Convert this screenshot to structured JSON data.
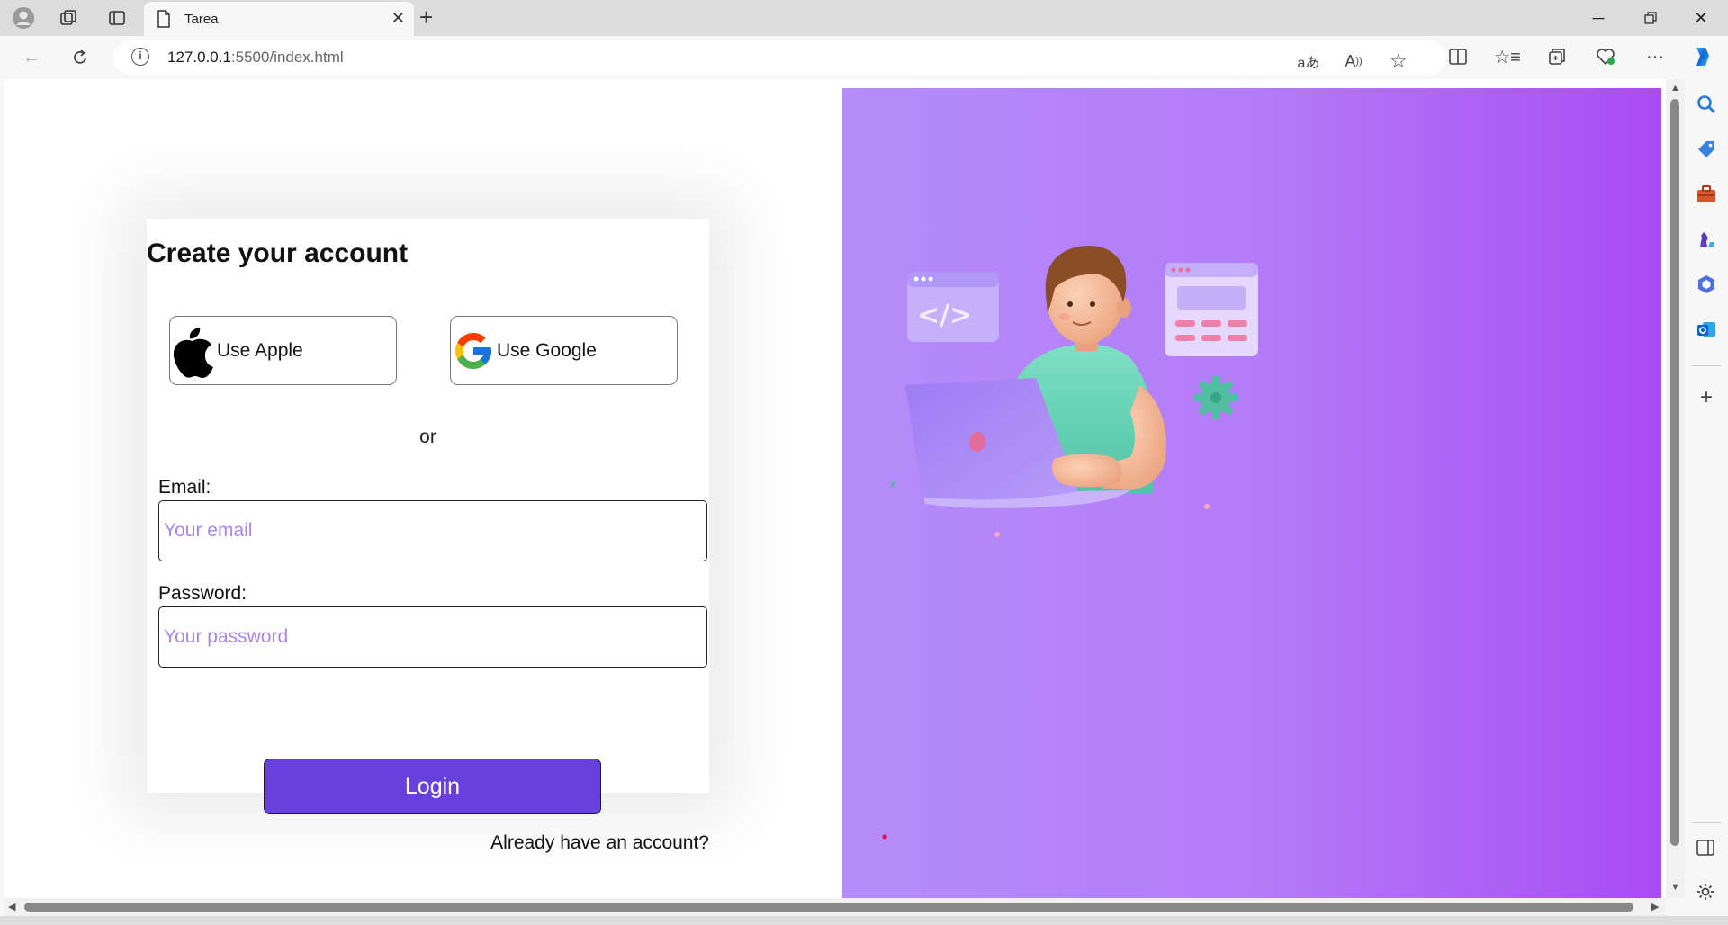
{
  "browser": {
    "tab_title": "Tarea",
    "url_host": "127.0.0.1",
    "url_path": ":5500/index.html"
  },
  "form": {
    "title": "Create your account",
    "apple_label": "Use Apple",
    "google_label": "Use Google",
    "or_text": "or",
    "email_label": "Email:",
    "email_placeholder": "Your email",
    "password_label": "Password:",
    "password_placeholder": "Your password",
    "login_label": "Login",
    "already_label": "Already have an account?"
  },
  "colors": {
    "accent": "#6840dc",
    "placeholder": "#a986ea",
    "panel_start": "#b58cf9",
    "panel_end": "#a94cf3"
  },
  "icons": [
    "profile-icon",
    "workspaces-icon",
    "tab-actions-icon",
    "page-icon",
    "close-icon",
    "new-tab-icon",
    "back-icon",
    "refresh-icon",
    "info-icon",
    "translate-icon",
    "read-aloud-icon",
    "favorite-icon",
    "split-screen-icon",
    "favorites-icon",
    "collections-icon",
    "browser-essentials-icon",
    "more-icon",
    "copilot-icon",
    "apple-icon",
    "google-icon"
  ]
}
